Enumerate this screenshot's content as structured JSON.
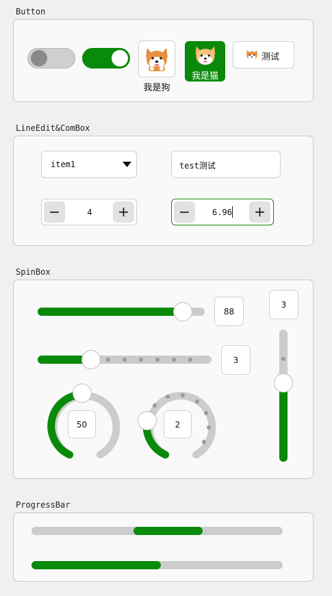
{
  "sections": {
    "button": "Button",
    "lineedit": "LineEdit&ComBox",
    "spinbox": "SpinBox",
    "progress": "ProgressBar"
  },
  "buttons": {
    "switch_off": false,
    "switch_on": true,
    "dog_label": "我是狗",
    "cat_label": "我是猫",
    "test_label": "测试"
  },
  "combo": {
    "selected": "item1"
  },
  "lineedit": {
    "value": "test测试"
  },
  "spin_int": {
    "value": "4",
    "minus": "−",
    "plus": "+"
  },
  "spin_double": {
    "value": "6.96",
    "minus": "−",
    "plus": "+"
  },
  "sliders": {
    "h_slider_1": {
      "value": 88,
      "max": 100,
      "display": "88"
    },
    "h_slider_2": {
      "value": 3,
      "max": 10,
      "display": "3"
    },
    "v_slider": {
      "value": 3,
      "max": 10,
      "display": "3"
    },
    "dial_1": {
      "value": 50,
      "max": 100,
      "display": "50"
    },
    "dial_2": {
      "value": 2,
      "max": 10,
      "display": "2"
    }
  },
  "progress": {
    "bar_1": {
      "start_fraction": 0.41,
      "end_fraction": 0.68
    },
    "bar_2": {
      "fraction": 0.51
    }
  },
  "colors": {
    "accent": "#0a8a0a",
    "track": "#cccccc",
    "panel": "#f9f9f9",
    "border": "#c9c9c9"
  },
  "icons": [
    "shiba-dog-icon",
    "cat-icon",
    "dropdown-arrow-icon",
    "minus-icon",
    "plus-icon"
  ]
}
